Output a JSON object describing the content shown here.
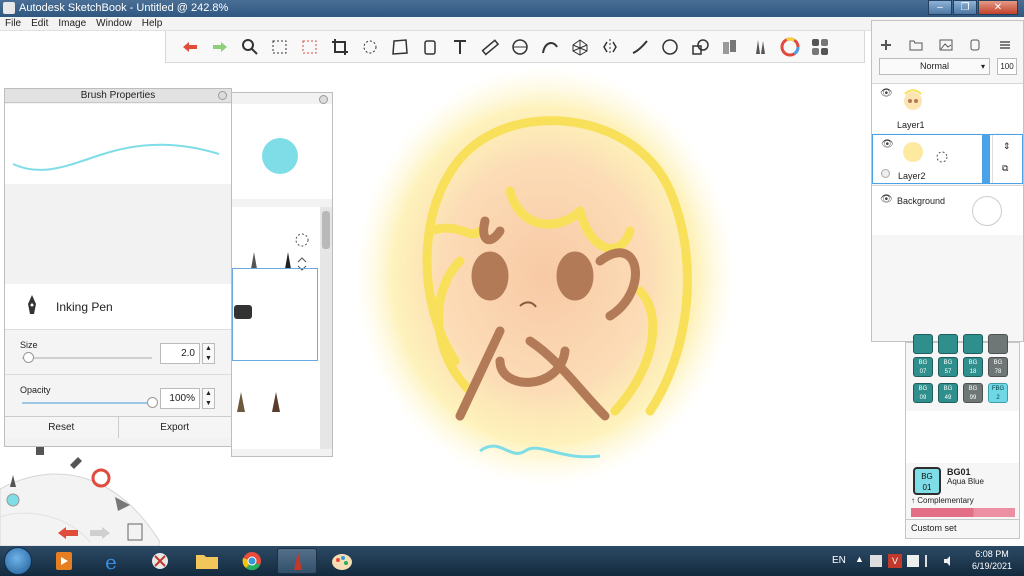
{
  "window": {
    "title": "Autodesk SketchBook - Untitled @ 242.8%"
  },
  "menu": [
    "File",
    "Edit",
    "Image",
    "Window",
    "Help"
  ],
  "toolbar": {
    "tools": [
      "undo-icon",
      "redo-icon",
      "zoom-icon",
      "select-icon",
      "lasso-select-icon",
      "crop-icon",
      "transform-icon",
      "distort-icon",
      "fill-icon",
      "text-icon",
      "ruler-icon",
      "ellipse-guide-icon",
      "french-curve-icon",
      "perspective-icon",
      "symmetry-icon",
      "stroke-icon",
      "shape-icon",
      "stamp-icon",
      "copic-library-icon",
      "brush-library-icon",
      "color-wheel-icon",
      "palette-icon"
    ]
  },
  "brush_properties": {
    "title": "Brush Properties",
    "brush_name": "Inking Pen",
    "size_label": "Size",
    "size_value": "2.0",
    "size_level": 0.02,
    "opacity_label": "Opacity",
    "opacity_value": "100%",
    "opacity_level": 1.0,
    "reset_label": "Reset",
    "export_label": "Export",
    "color": "#7fdde7"
  },
  "layers": {
    "blend_mode": "Normal",
    "opacity": "100",
    "items": [
      {
        "name": "Layer1"
      },
      {
        "name": "Layer2"
      },
      {
        "name": "Background"
      }
    ]
  },
  "copic": {
    "chips_row1": [
      {
        "line1": "BG",
        "line2": "07",
        "style": "normal"
      },
      {
        "line1": "BG",
        "line2": "57",
        "style": "normal"
      },
      {
        "line1": "BG",
        "line2": "18",
        "style": "normal"
      },
      {
        "line1": "BG",
        "line2": "78",
        "style": "grey"
      }
    ],
    "chips_row2": [
      {
        "line1": "BG",
        "line2": "09",
        "style": "normal"
      },
      {
        "line1": "BG",
        "line2": "49",
        "style": "normal"
      },
      {
        "line1": "BG",
        "line2": "99",
        "style": "grey"
      },
      {
        "line1": "FBG",
        "line2": "2",
        "style": "bright"
      }
    ],
    "current": {
      "line1": "BG",
      "line2": "01",
      "code": "BG01",
      "name": "Aqua Blue"
    },
    "complementary_label": "Complementary",
    "custom_set_label": "Custom set"
  },
  "taskbar": {
    "language": "EN",
    "time": "6:08 PM",
    "date": "6/19/2021"
  }
}
